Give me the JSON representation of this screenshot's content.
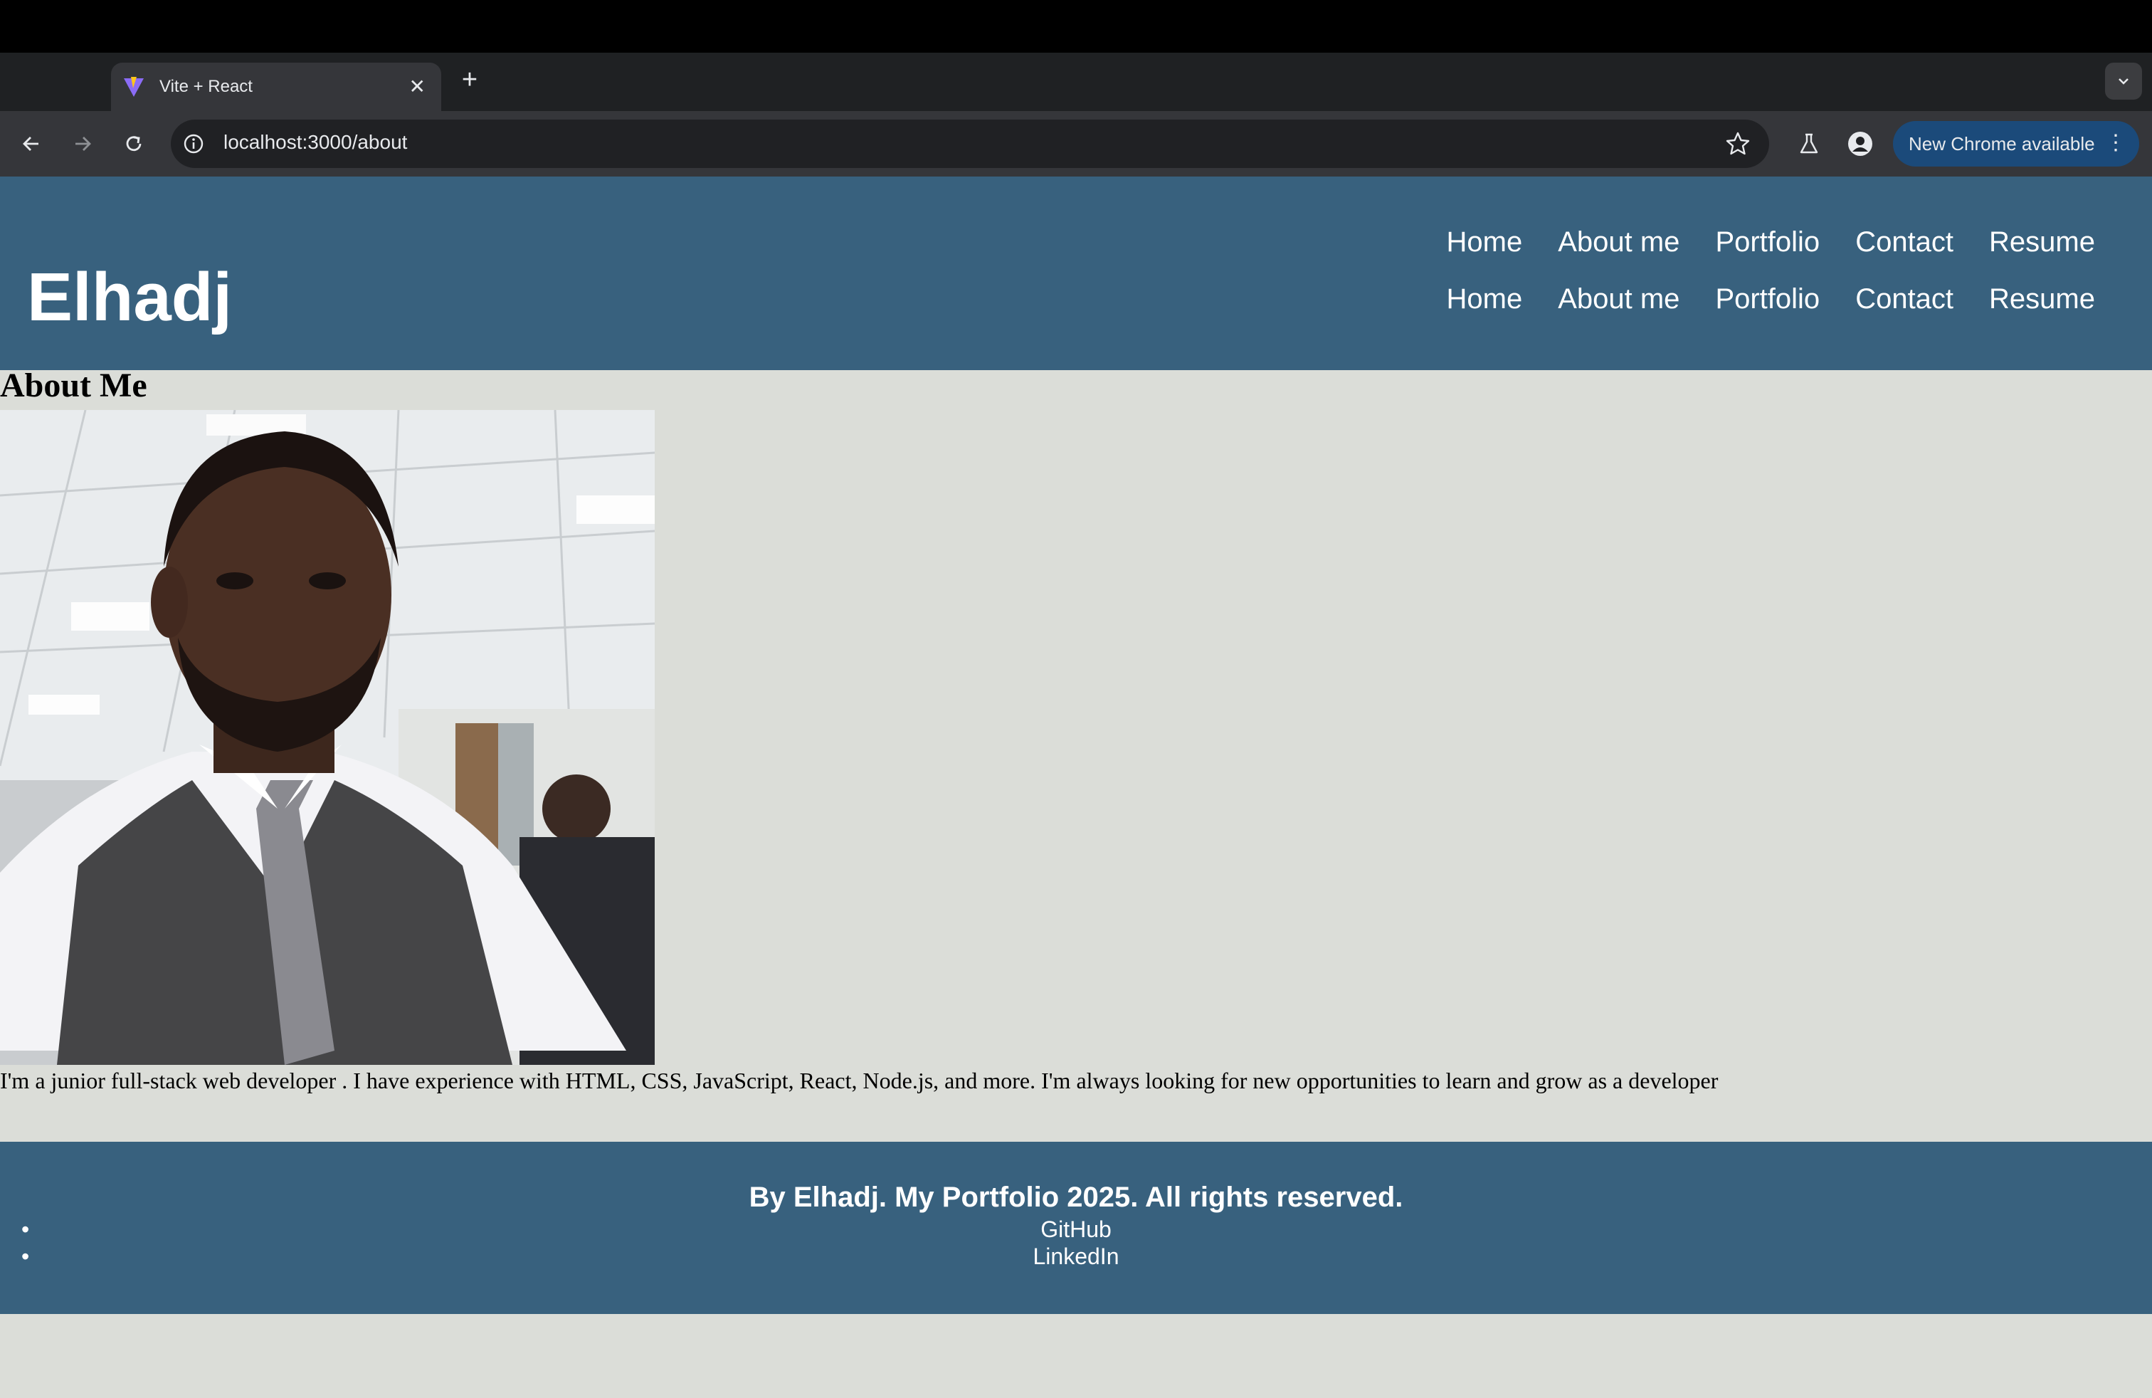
{
  "browser": {
    "tab_title": "Vite + React",
    "tab_close": "✕",
    "new_tab": "+",
    "url": "localhost:3000/about",
    "update_label": "New Chrome available",
    "update_menu": "⋮"
  },
  "site": {
    "brand": "Elhadj",
    "nav": [
      "Home",
      "About me",
      "Portfolio",
      "Contact",
      "Resume"
    ]
  },
  "about": {
    "heading": "About Me",
    "bio": "I'm a junior full-stack web developer . I have experience with HTML, CSS, JavaScript, React, Node.js, and more. I'm always looking for new opportunities to learn and grow as a developer"
  },
  "footer": {
    "copyright": "By Elhadj. My Portfolio 2025. All rights reserved.",
    "links": [
      "GitHub",
      "LinkedIn"
    ]
  },
  "colors": {
    "header_bg": "#38617e",
    "page_bg": "#dbddd8",
    "update_pill": "#1b4a7a"
  }
}
